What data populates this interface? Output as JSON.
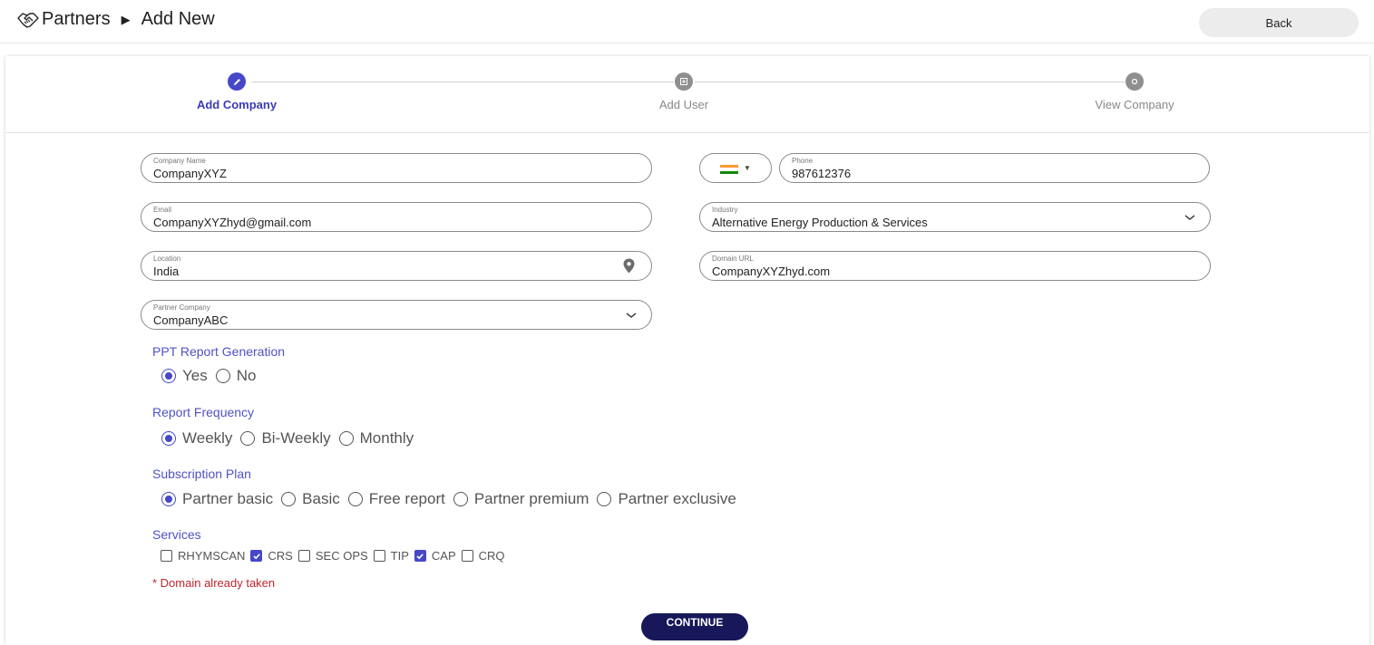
{
  "header": {
    "breadcrumb_root": "Partners",
    "breadcrumb_current": "Add New",
    "back_label": "Back"
  },
  "stepper": {
    "steps": [
      {
        "label": "Add Company",
        "state": "active"
      },
      {
        "label": "Add User",
        "state": "inactive"
      },
      {
        "label": "View Company",
        "state": "inactive"
      }
    ]
  },
  "form": {
    "company_name": {
      "label": "Company Name",
      "value": "CompanyXYZ"
    },
    "phone": {
      "label": "Phone",
      "value": "987612376",
      "country_icon": "india-flag-icon"
    },
    "email": {
      "label": "Email",
      "value": "CompanyXYZhyd@gmail.com"
    },
    "industry": {
      "label": "Industry",
      "value": "Alternative Energy Production & Services"
    },
    "location": {
      "label": "Location",
      "value": "India"
    },
    "domain_url": {
      "label": "Domain URL",
      "value": "CompanyXYZhyd.com"
    },
    "partner_company": {
      "label": "Partner Company",
      "value": "CompanyABC"
    }
  },
  "ppt_report": {
    "title": "PPT Report Generation",
    "options": [
      "Yes",
      "No"
    ],
    "selected": "Yes"
  },
  "report_frequency": {
    "title": "Report Frequency",
    "options": [
      "Weekly",
      "Bi-Weekly",
      "Monthly"
    ],
    "selected": "Weekly"
  },
  "subscription_plan": {
    "title": "Subscription Plan",
    "options": [
      "Partner basic",
      "Basic",
      "Free report",
      "Partner premium",
      "Partner exclusive"
    ],
    "selected": "Partner basic"
  },
  "services": {
    "title": "Services",
    "options": [
      {
        "label": "RHYMSCAN",
        "checked": false
      },
      {
        "label": "CRS",
        "checked": true
      },
      {
        "label": "SEC OPS",
        "checked": false
      },
      {
        "label": "TIP",
        "checked": false
      },
      {
        "label": "CAP",
        "checked": true
      },
      {
        "label": "CRQ",
        "checked": false
      }
    ]
  },
  "error_message": "* Domain already taken",
  "continue_label": "CONTINUE",
  "colors": {
    "accent": "#4648c8",
    "section_title": "#4f52c6",
    "error": "#c0262d",
    "continue_bg": "#17175a"
  }
}
